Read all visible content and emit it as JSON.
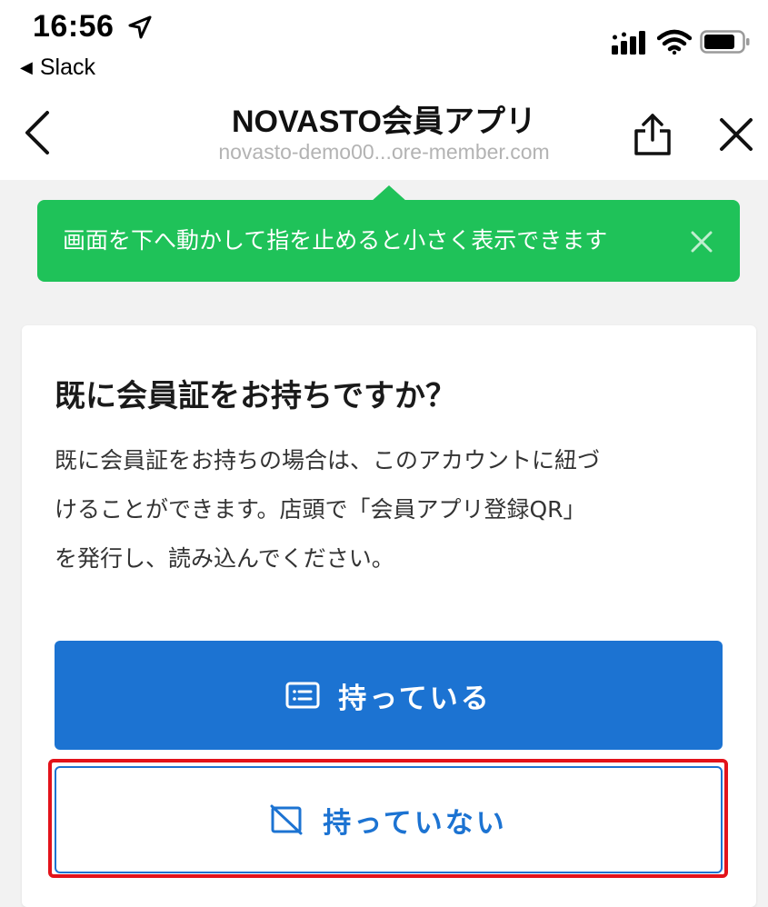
{
  "status_bar": {
    "time": "16:56",
    "back_app": "Slack",
    "back_glyph": "◀"
  },
  "nav": {
    "title": "NOVASTO会員アプリ",
    "url": "novasto-demo00...ore-member.com"
  },
  "tooltip": {
    "text": "画面を下へ動かして指を止めると小さく表示できます"
  },
  "card": {
    "title": "既に会員証をお持ちですか？",
    "body_lines": [
      "既に会員証をお持ちの場合は、このアカウントに紐づ",
      "けることができます。店頭で「会員アプリ登録QR」",
      "を発行し、読み込んでください。"
    ]
  },
  "buttons": {
    "have": "持っている",
    "not_have": "持っていない"
  },
  "colors": {
    "tooltip_bg": "#1fc259",
    "primary": "#1c73d2",
    "highlight": "#e3131b"
  },
  "icons": {
    "location": "location-arrow-icon",
    "signal": "cellular-signal-icon",
    "wifi": "wifi-icon",
    "battery": "battery-icon",
    "back": "chevron-left-icon",
    "share": "share-icon",
    "close": "close-icon",
    "tooltip_close": "close-icon",
    "member_card": "member-card-icon",
    "no_card": "no-card-icon"
  }
}
